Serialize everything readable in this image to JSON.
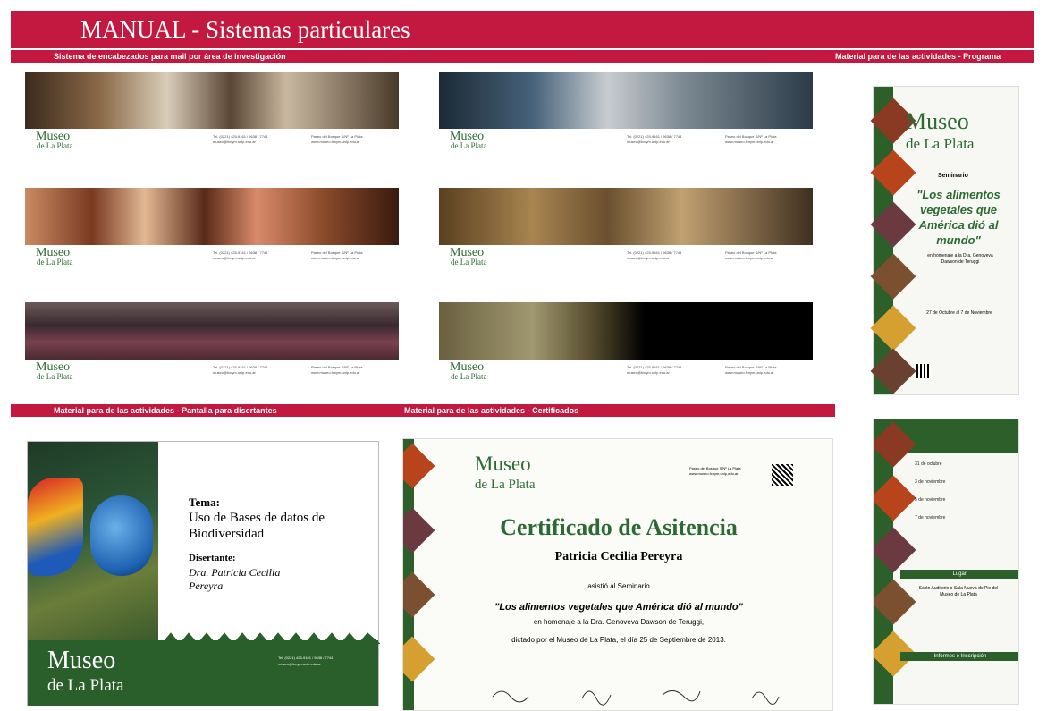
{
  "title": "MANUAL - Sistemas particulares",
  "sections": {
    "mail_headers": "Sistema de encabezados para mail por área de investigación",
    "program": "Material para de las actividades - Programa",
    "slides": "Material para de las actividades - Pantalla para disertantes",
    "certificates": "Material para de las actividades - Certificados"
  },
  "logo": {
    "line1": "Museo",
    "line2": "de La Plata"
  },
  "banner_contact": {
    "left": "Tel. (0221) 425-9161 / 9638 / 7744 museo@fcnym.unlp.edu.ar",
    "right": "Paseo del Bosque S/Nº La Plata www.museo.fcnym.unlp.edu.ar"
  },
  "brochure": {
    "kind": "Seminario",
    "title": "\"Los alimentos vegetales que América dió al mundo\"",
    "homage": "en homenaje a la Dra. Genoveva Dawson de Teruggi",
    "dates": "27 de Octubre al 7 de Noviembre"
  },
  "program_panel": {
    "entries": [
      "31 de octubre",
      "3 de noviembre",
      "5 de noviembre",
      "7 de noviembre"
    ],
    "place_label": "Lugar:",
    "place": "Salón Auditorio o Sala Nueva de Pie del Museo de La Plata",
    "info_label": "Informes e Inscripción"
  },
  "presenter": {
    "topic_label": "Tema:",
    "topic": "Uso de Bases de datos de Biodiversidad",
    "speaker_label": "Disertante:",
    "speaker": "Dra. Patricia Cecilia Pereyra"
  },
  "certificate": {
    "title": "Certificado de Asitencia",
    "name": "Patricia Cecilia Pereyra",
    "line1": "asistió al Seminario",
    "seminar": "\"Los alimentos vegetales que América dió al mundo\"",
    "line2": "en homenaje a la Dra. Genoveva Dawson de Teruggi,",
    "line3": "dictado por el Museo de La Plata, el día 25 de Septiembre de 2013."
  },
  "colors": {
    "crimson": "#c3183f",
    "green": "#2c5f2a"
  }
}
